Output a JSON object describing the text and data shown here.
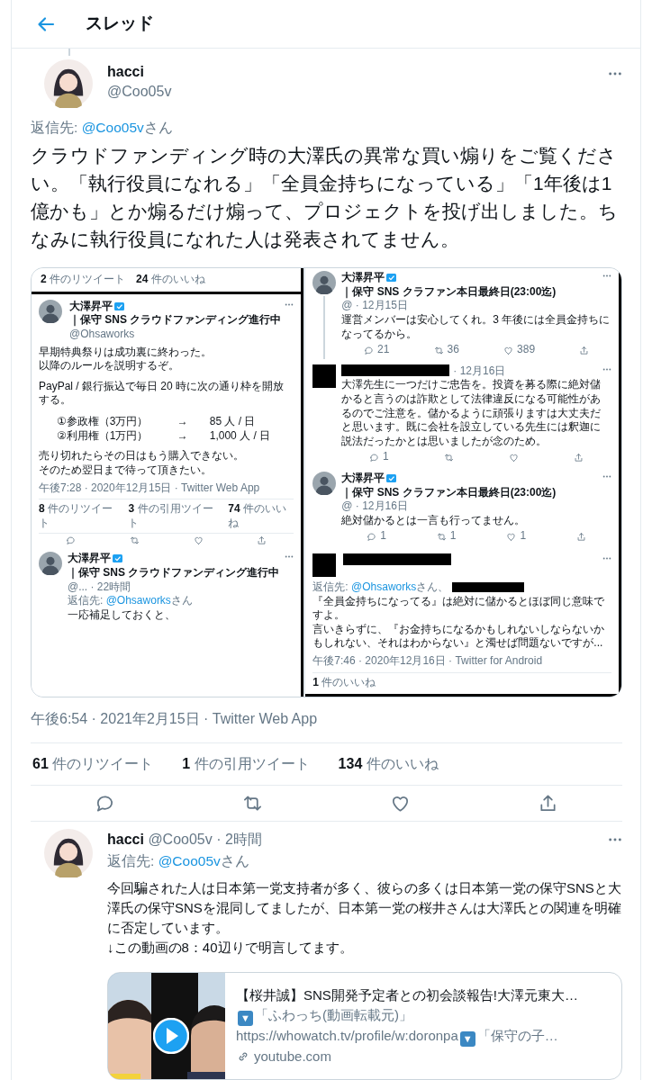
{
  "header": {
    "title": "スレッド"
  },
  "main_tweet": {
    "author": {
      "name": "hacci",
      "handle": "@Coo05v"
    },
    "reply_to": {
      "label": "返信先:",
      "mention": "@Coo05v",
      "suffix": "さん"
    },
    "text": "クラウドファンディング時の大澤氏の異常な買い煽りをご覧ください。「執行役員になれる」「全員金持ちになっている」「1年後は1億かも」とか煽るだけ煽って、プロジェクトを投げ出しました。ちなみに執行役員になれた人は発表されてません。",
    "screenshots": [
      {
        "items": [
          {
            "kind": "stats",
            "stats": [
              {
                "count": "2",
                "label": "件のリツイート"
              },
              {
                "count": "24",
                "label": "件のいいね"
              }
            ]
          },
          {
            "kind": "expanded",
            "author": {
              "name": "大澤昇平",
              "verified": true,
              "bio": "｜保守 SNS クラウドファンディング進行中",
              "handle": "@Ohsaworks"
            },
            "body": [
              {
                "kind": "text",
                "lines": [
                  "早期特典祭りは成功裏に終わった。",
                  "以降のルールを説明するぞ。"
                ]
              },
              {
                "kind": "text",
                "lines": [
                  "PayPal / 銀行振込で毎日 20 時に次の通り枠を開放する。"
                ]
              },
              {
                "kind": "tiers",
                "rows": [
                  {
                    "name": "①参政権（3万円）",
                    "arrow": "→",
                    "quota": "85 人 / 日"
                  },
                  {
                    "name": "②利用権（1万円）",
                    "arrow": "→",
                    "quota": "1,000 人 / 日"
                  }
                ]
              },
              {
                "kind": "text",
                "lines": [
                  "売り切れたらその日はもう購入できない。",
                  "そのため翌日まで待って頂きたい。"
                ]
              }
            ],
            "timestamp": "午後7:28 · 2020年12月15日 · Twitter Web App",
            "stats": [
              {
                "count": "8",
                "label": "件のリツイート"
              },
              {
                "count": "3",
                "label": "件の引用ツイート"
              },
              {
                "count": "74",
                "label": "件のいいね"
              }
            ],
            "actions": [
              {
                "kind": "reply"
              },
              {
                "kind": "retweet"
              },
              {
                "kind": "like"
              },
              {
                "kind": "share"
              }
            ]
          },
          {
            "kind": "compact",
            "author": {
              "name": "大澤昇平",
              "verified": true,
              "bio": "｜保守 SNS クラウドファンディング進行中",
              "meta": "@... · 22時間"
            },
            "reply_to": {
              "label": "返信先:",
              "mention": "@Ohsaworks",
              "suffix": "さん"
            },
            "text": "一応補足しておくと、"
          }
        ]
      },
      {
        "items": [
          {
            "kind": "compact",
            "thread_line": true,
            "author": {
              "name": "大澤昇平",
              "verified": true,
              "bio": "｜保守 SNS クラファン本日最終日(23:00迄)",
              "meta": "@ · 12月15日"
            },
            "text": "運営メンバーは安心してくれ。3 年後には全員金持ちになってるから。",
            "actions": [
              {
                "kind": "reply",
                "count": "21"
              },
              {
                "kind": "retweet",
                "count": "36"
              },
              {
                "kind": "like",
                "count": "389"
              },
              {
                "kind": "share"
              }
            ]
          },
          {
            "kind": "compact",
            "author": {
              "redacted": true,
              "meta": "· 12月16日"
            },
            "text": "大澤先生に一つだけご忠告を。投資を募る際に絶対儲かると言うのは詐欺として法律違反になる可能性があるのでご注意を。儲かるように頑張りますは大丈夫だと思います。既に会社を設立している先生には釈迦に説法だったかとは思いましたが念のため。",
            "actions": [
              {
                "kind": "reply",
                "count": "1"
              },
              {
                "kind": "retweet"
              },
              {
                "kind": "like"
              },
              {
                "kind": "share"
              }
            ]
          },
          {
            "kind": "compact",
            "author": {
              "name": "大澤昇平",
              "verified": true,
              "bio": "｜保守 SNS クラファン本日最終日(23:00迄)",
              "meta": "@ · 12月16日"
            },
            "text": "絶対儲かるとは一言も行ってません。",
            "actions": [
              {
                "kind": "reply",
                "count": "1"
              },
              {
                "kind": "retweet",
                "count": "1"
              },
              {
                "kind": "like",
                "count": "1"
              },
              {
                "kind": "share"
              }
            ]
          },
          {
            "kind": "expanded",
            "author": {
              "redacted": true
            },
            "reply_to": {
              "label": "返信先:",
              "mention": "@Ohsaworks",
              "suffix": "さん、",
              "redacted_extra": true
            },
            "body": [
              {
                "kind": "text",
                "lines": [
                  "『全員金持ちになってる』は絶対に儲かるとほぼ同じ意味ですよ。",
                  "言いきらずに、『お金持ちになるかもしれないしならないかもしれない、それはわからない』と濁せば問題ないですが..."
                ]
              }
            ],
            "timestamp": "午後7:46 · 2020年12月16日 · Twitter for Android",
            "stats": [
              {
                "count": "1",
                "label": "件のいいね"
              }
            ]
          }
        ]
      }
    ],
    "timestamp": "午後6:54 · 2021年2月15日 · Twitter Web App",
    "stats": [
      {
        "count": "61",
        "label": "件のリツイート"
      },
      {
        "count": "1",
        "label": "件の引用ツイート"
      },
      {
        "count": "134",
        "label": "件のいいね"
      }
    ],
    "actions": [
      {
        "kind": "reply"
      },
      {
        "kind": "retweet"
      },
      {
        "kind": "like"
      },
      {
        "kind": "share"
      }
    ]
  },
  "reply_tweet": {
    "author": {
      "name": "hacci",
      "handle": "@Coo05v"
    },
    "time": "· 2時間",
    "reply_to": {
      "label": "返信先:",
      "mention": "@Coo05v",
      "suffix": "さん"
    },
    "text": "今回騙された人は日本第一党支持者が多く、彼らの多くは日本第一党の保守SNSと大澤氏の保守SNSを混同してましたが、日本第一党の桜井さんは大澤氏との関連を明確に否定しています。\n↓この動画の8：40辺りで明言してます。",
    "link_card": {
      "title": "【桜井誠】SNS開発予定者との初会談報告!大澤元東大…",
      "description": [
        [
          {
            "kind": "emoji",
            "text": "▼"
          },
          {
            "kind": "text",
            "text": "「ふわっち(動画転載元)」"
          }
        ],
        [
          {
            "kind": "text",
            "text": "https://whowatch.tv/profile/w:doronpa"
          },
          {
            "kind": "emoji",
            "text": "▼"
          },
          {
            "kind": "text",
            "text": "「保守の子…"
          }
        ]
      ],
      "domain": "youtube.com"
    }
  }
}
